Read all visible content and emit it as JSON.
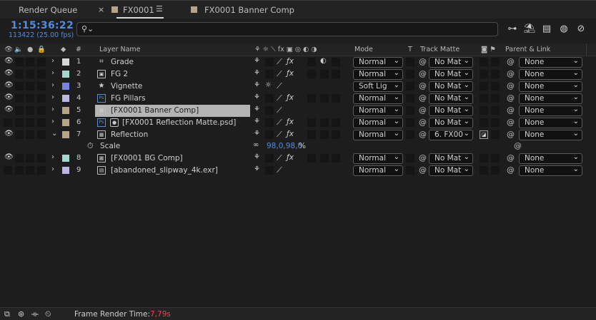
{
  "tabs": [
    {
      "label": "Render Queue"
    },
    {
      "label": "FX0001"
    },
    {
      "label": "FX0001 Banner Comp"
    }
  ],
  "tab_close_glyph": "×",
  "tab_menu_glyph": "☰",
  "timecode": "1:15:36:22",
  "frames": "113422 (25.00 fps)",
  "search": {
    "placeholder": ""
  },
  "headers": {
    "layer_name": "Layer Name",
    "mode": "Mode",
    "t": "T",
    "track_matte": "Track Matte",
    "parent_link": "Parent & Link"
  },
  "layers": [
    {
      "num": "1",
      "name": "Grade",
      "icon": "adjustment-icon",
      "glyph": "⌗",
      "color": "#d8d8d8",
      "mode": "Normal",
      "matte": "No Mat",
      "parent": "None",
      "eye": true
    },
    {
      "num": "2",
      "name": "FG 2",
      "icon": "precomp-icon",
      "glyph": "▣",
      "color": "#a6d5d0",
      "mode": "Normal",
      "matte": "No Mat",
      "parent": "None",
      "eye": true
    },
    {
      "num": "3",
      "name": "Vignette",
      "icon": "star-icon",
      "glyph": "★",
      "color": "#7a84e0",
      "mode": "Soft Lig",
      "matte": "No Mat",
      "parent": "None",
      "eye": true
    },
    {
      "num": "4",
      "name": "FG Pillars",
      "icon": "psd-icon",
      "glyph": "Ps",
      "color": "#bab7e0",
      "mode": "Normal",
      "matte": "No Mat",
      "parent": "None",
      "eye": true
    },
    {
      "num": "5",
      "name": "[FX0001 Banner Comp]",
      "icon": "comp-icon",
      "glyph": "▦",
      "color": "#b6a488",
      "mode": "Normal",
      "matte": "No Mat",
      "parent": "None",
      "eye": true
    },
    {
      "num": "6",
      "name": "[FX0001 Reflection Matte.psd]",
      "icon": "psd-icon",
      "glyph": "Ps",
      "color": "#b6a488",
      "mode": "Normal",
      "matte": "No Mat",
      "parent": "None",
      "eye": false
    },
    {
      "num": "7",
      "name": "Reflection",
      "icon": "comp-icon",
      "glyph": "▦",
      "color": "#b6a488",
      "mode": "Normal",
      "matte": "6. FX00",
      "parent": "None",
      "eye": true
    },
    {
      "num": "8",
      "name": "[FX0001 BG Comp]",
      "icon": "comp-icon",
      "glyph": "▦",
      "color": "#a6d5d0",
      "mode": "Normal",
      "matte": "No Mat",
      "parent": "None",
      "eye": true
    },
    {
      "num": "9",
      "name": "[abandoned_slipway_4k.exr]",
      "icon": "footage-icon",
      "glyph": "▤",
      "color": "#bab7e0",
      "mode": "Normal",
      "matte": "No Mat",
      "parent": "None",
      "eye": false
    }
  ],
  "property": {
    "name": "Scale",
    "value": "98,0,98,0",
    "unit": "%"
  },
  "frame_render_time": {
    "label": "Frame Render Time:",
    "value": "7,79s"
  },
  "colors": {
    "accent": "#4f8de3",
    "warning": "#e5484d",
    "selection": "#b4b4b4"
  }
}
